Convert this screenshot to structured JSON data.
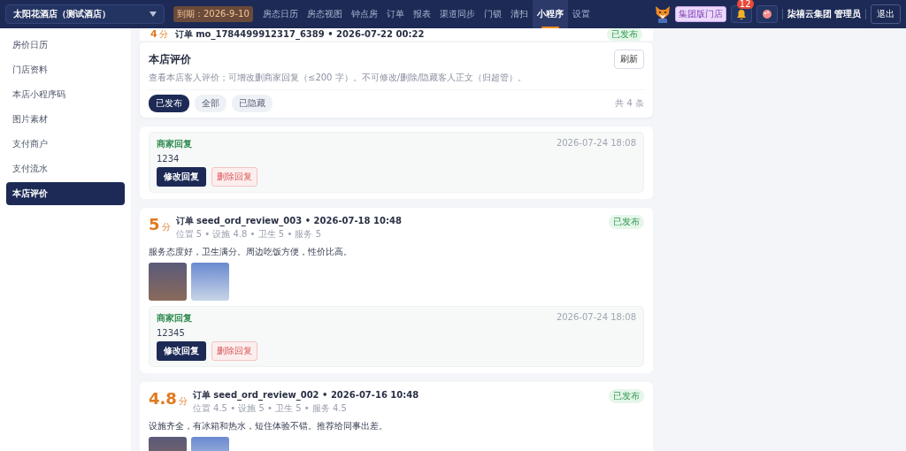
{
  "topbar": {
    "store": "太阳花酒店（测试酒店）",
    "expiry": "到期：2026-9-10",
    "nav": [
      {
        "label": "房态日历",
        "selected": false
      },
      {
        "label": "房态视图",
        "selected": false
      },
      {
        "label": "钟点房",
        "selected": false
      },
      {
        "label": "订单",
        "selected": false
      },
      {
        "label": "报表",
        "selected": false
      },
      {
        "label": "渠道同步",
        "selected": false
      },
      {
        "label": "门锁",
        "selected": false
      },
      {
        "label": "清扫",
        "selected": false
      },
      {
        "label": "小程序",
        "selected": true
      },
      {
        "label": "设置",
        "selected": false
      }
    ],
    "tag": "集团版门店",
    "notifications": "12",
    "user": "柒禧云集团 管理员",
    "logout": "退出"
  },
  "sidebar": {
    "items": [
      {
        "label": "房价日历",
        "selected": false
      },
      {
        "label": "门店资料",
        "selected": false
      },
      {
        "label": "本店小程序码",
        "selected": false
      },
      {
        "label": "图片素材",
        "selected": false
      },
      {
        "label": "支付商户",
        "selected": false
      },
      {
        "label": "支付流水",
        "selected": false
      },
      {
        "label": "本店评价",
        "selected": true
      }
    ]
  },
  "partial_review": {
    "score": "4",
    "unit": "分",
    "order": "订单 mo_1784499912317_6389 • 2026-07-22 00:22",
    "status": "已发布"
  },
  "header": {
    "title": "本店评价",
    "description": "查看本店客人评价；可增改删商家回复（≤200 字）。不可修改/删除/隐藏客人正文（归超管）。",
    "refresh": "刷新",
    "filters": [
      {
        "label": "已发布",
        "selected": true
      },
      {
        "label": "全部",
        "selected": false
      },
      {
        "label": "已隐藏",
        "selected": false
      }
    ],
    "count": "共 4 条"
  },
  "reviews": [
    {
      "reply": {
        "label": "商家回复",
        "date": "2026-07-24 18:08",
        "text": "1234",
        "edit": "修改回复",
        "delete": "删除回复"
      }
    },
    {
      "score": "5",
      "unit": "分",
      "order": "订单 seed_ord_review_003 • 2026-07-18 10:48",
      "ratings": "位置 5 • 设施 4.8 • 卫生 5 • 服务 5",
      "status": "已发布",
      "text": "服务态度好，卫生满分。周边吃饭方便，性价比高。",
      "reply": {
        "label": "商家回复",
        "date": "2026-07-24 18:08",
        "text": "12345",
        "edit": "修改回复",
        "delete": "删除回复"
      }
    },
    {
      "score": "4.8",
      "unit": "分",
      "order": "订单 seed_ord_review_002 • 2026-07-16 10:48",
      "ratings": "位置 4.5 • 设施 5 • 卫生 5 • 服务 4.5",
      "status": "已发布",
      "text": "设施齐全，有冰箱和热水，短住体验不错。推荐给同事出差。"
    }
  ]
}
